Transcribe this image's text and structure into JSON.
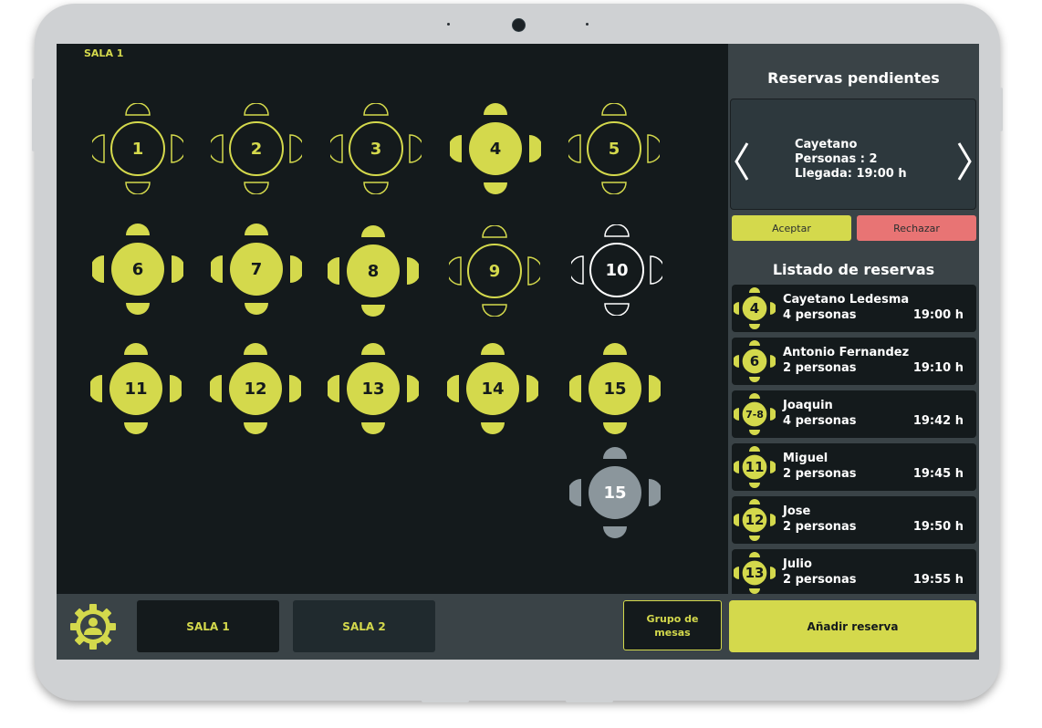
{
  "colors": {
    "accent": "#d4d94c",
    "reject": "#e87474",
    "background": "#141a1c",
    "panel": "#3a4347",
    "selected_white": "#ffffff",
    "disabled_gray": "#8b969c"
  },
  "floor": {
    "room_label": "SALA 1",
    "tables": [
      {
        "number": "1",
        "status": "free"
      },
      {
        "number": "2",
        "status": "free"
      },
      {
        "number": "3",
        "status": "free"
      },
      {
        "number": "4",
        "status": "occupied"
      },
      {
        "number": "5",
        "status": "free"
      },
      {
        "number": "6",
        "status": "occupied"
      },
      {
        "number": "7",
        "status": "occupied"
      },
      {
        "number": "8",
        "status": "occupied"
      },
      {
        "number": "9",
        "status": "free"
      },
      {
        "number": "10",
        "status": "selected"
      },
      {
        "number": "11",
        "status": "occupied"
      },
      {
        "number": "12",
        "status": "occupied"
      },
      {
        "number": "13",
        "status": "occupied"
      },
      {
        "number": "14",
        "status": "occupied"
      },
      {
        "number": "15",
        "status": "occupied"
      },
      {
        "number": "15",
        "status": "disabled"
      }
    ]
  },
  "sidebar": {
    "pending_title": "Reservas pendientes",
    "pending": {
      "name": "Cayetano",
      "people": "Personas : 2",
      "arrival": "Llegada: 19:00 h"
    },
    "accept_label": "Aceptar",
    "reject_label": "Rechazar",
    "list_title": "Listado de reservas",
    "reservations": [
      {
        "table": "4",
        "name": "Cayetano Ledesma",
        "people": "4 personas",
        "time": "19:00 h"
      },
      {
        "table": "6",
        "name": "Antonio Fernandez",
        "people": "2 personas",
        "time": "19:10 h"
      },
      {
        "table": "7-8",
        "name": "Joaquin",
        "people": "4 personas",
        "time": "19:42 h"
      },
      {
        "table": "11",
        "name": "Miguel",
        "people": "2 personas",
        "time": "19:45 h"
      },
      {
        "table": "12",
        "name": "Jose",
        "people": "2 personas",
        "time": "19:50 h"
      },
      {
        "table": "13",
        "name": " Julio",
        "people": "2 personas",
        "time": "19:55 h"
      }
    ]
  },
  "bottom": {
    "tab1_label": "SALA 1",
    "tab2_label": "SALA 2",
    "group_label": "Grupo de mesas",
    "add_label": "Añadir reserva"
  }
}
